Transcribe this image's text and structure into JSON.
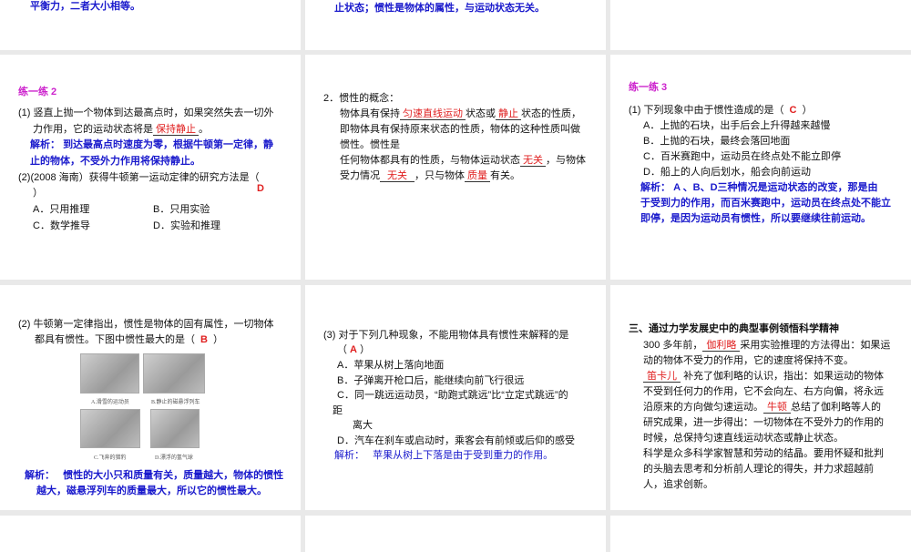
{
  "slide1": {
    "text": "平衡力，二者大小相等。"
  },
  "slide2": {
    "text": "止状态；惯性是物体的属性，与运动状态无关。"
  },
  "slide4": {
    "title": "练一练  2",
    "q1_l1": "(1) 竖直上抛一个物体到达最高点时，如果突然失去一切外",
    "q1_l2": "力作用，它的运动状态将是",
    "q1_ans": "保持静止",
    "q1_end": "。",
    "analysis_label": "解析：",
    "a_l1": "到达最高点时速度为零，根据牛顿第一定律，静",
    "a_l2": "止的物体，不受外力作用将保持静止。",
    "q2_l1": "(2)(2008 海南）获得牛顿第一运动定律的研究方法是（",
    "q2_l2": "）",
    "q2_ans": "D",
    "options": [
      "A．只用推理",
      "B．只用实验",
      "C．数学推导",
      "D．实验和推理"
    ]
  },
  "slide5": {
    "heading": "2．惯性的概念：",
    "l1_a": "物体具有保持",
    "l1_ans1": "匀速直线运动",
    "l1_b": "状态或",
    "l1_ans2": "静止",
    "l1_c": "状态的性质，",
    "l2": "即物体具有保持原来状态的性质，物体的这种性质叫做",
    "l3": "惯性。惯性是",
    "l4_a": "任何物体都具有的性质，与物体运动状态",
    "l4_ans": "无关",
    "l4_b": "，与物体",
    "l5_a": "受力情况",
    "l5_ans1": "无关",
    "l5_b": "，只与物体",
    "l5_ans2": "质量",
    "l5_c": "有关。"
  },
  "slide6": {
    "title": "练一练  3",
    "q": "(1) 下列现象中由于惯性造成的是（",
    "q_ans": "C",
    "q_end": "）",
    "options": [
      "A．上抛的石块，出手后会上升得越来越慢",
      "B．上抛的石块，最终会落回地面",
      "C．百米赛跑中，运动员在终点处不能立即停",
      "D．船上的人向后划水，船会向前运动"
    ],
    "analysis_label": "解析：",
    "a_l1": "A 、B、D三种情况是运动状态的改变，那是由",
    "a_l2": "于受到力的作用，而百米赛跑中，运动员在终点处不能立",
    "a_l3": "即停，是因为运动员有惯性，所以要继续往前运动。"
  },
  "slide7": {
    "q_l1": "(2) 牛顿第一定律指出，惯性是物体的固有属性，一切物体",
    "q_l2": "都具有惯性。下图中惯性最大的是（",
    "q_ans": "B",
    "q_end": "）",
    "captions": [
      "A.滑雪的运动员",
      "B.静止的磁悬浮列车",
      "C.飞奔的猎豹",
      "D.漂浮的氢气球"
    ],
    "analysis_label": "解析：",
    "a_l1": "惯性的大小只和质量有关，质量越大，物体的惯性",
    "a_l2": "越大，磁悬浮列车的质量最大，所以它的惯性最大。"
  },
  "slide8": {
    "q_l1": "(3) 对于下列几种现象，不能用物体具有惯性来解释的是",
    "q_l2a": "（",
    "q_ans": "A",
    "q_l2b": "）",
    "opt_a": "A．苹果从树上落向地面",
    "opt_b": "B．子弹离开枪口后，能继续向前飞行很远",
    "opt_c1": "C．同一跳远运动员，“助跑式跳远”比“立定式跳远”的",
    "opt_c2": "距",
    "opt_c3": "离大",
    "opt_d": "D．汽车在刹车或启动时，乘客会有前倾或后仰的感受",
    "analysis_label": "解析：",
    "analysis": "苹果从树上下落是由于受到重力的作用。"
  },
  "slide9": {
    "title": "三、通过力学发展史中的典型事例领悟科学精神",
    "l1_a": "300 多年前，",
    "l1_ans": "伽利略",
    "l1_b": "采用实验推理的方法得出：如果运",
    "l2": "动的物体不受力的作用，它的速度将保持不变。",
    "l3_ans": "笛卡儿",
    "l3_b": "补充了伽利略的认识，指出：如果运动的物体",
    "l4": "不受到任何力的作用，它不会向左、右方向偏，将永远",
    "l5_a": "沿原来的方向做匀速运动。",
    "l5_ans": "牛顿",
    "l5_b": "总结了伽利略等人的",
    "l6": "研究成果，进一步得出：一切物体在不受外力的作用的",
    "l7": "时候，总保持匀速直线运动状态或静止状态。",
    "l8": "科学是众多科学家智慧和劳动的结晶。要用怀疑和批判",
    "l9": "的头脑去思考和分析前人理论的得失，并力求超越前",
    "l10": "人，追求创新。"
  }
}
